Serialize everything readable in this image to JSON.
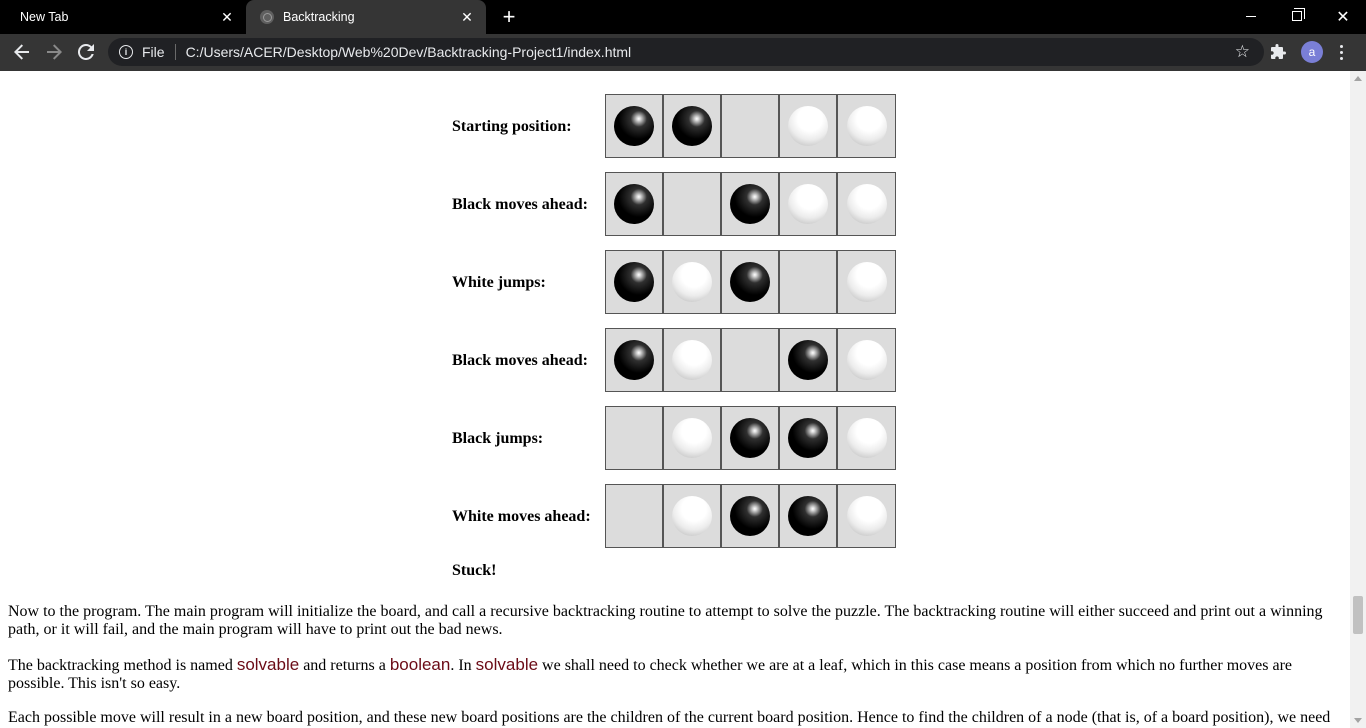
{
  "browser": {
    "tabs": [
      {
        "title": "New Tab",
        "active": false
      },
      {
        "title": "Backtracking",
        "active": true
      }
    ],
    "address": {
      "scheme_label": "File",
      "url": "C:/Users/ACER/Desktop/Web%20Dev/Backtracking-Project1/index.html"
    },
    "profile_initial": "a",
    "icons": [
      "back-icon",
      "forward-icon",
      "reload-icon",
      "info-icon",
      "star-icon",
      "extensions-icon",
      "menu-icon"
    ]
  },
  "moves": [
    {
      "label": "Starting position:",
      "board": [
        "black",
        "black",
        "empty",
        "white",
        "white"
      ]
    },
    {
      "label": "Black moves ahead:",
      "board": [
        "black",
        "empty",
        "black",
        "white",
        "white"
      ]
    },
    {
      "label": "White jumps:",
      "board": [
        "black",
        "white",
        "black",
        "empty",
        "white"
      ]
    },
    {
      "label": "Black moves ahead:",
      "board": [
        "black",
        "white",
        "empty",
        "black",
        "white"
      ]
    },
    {
      "label": "Black jumps:",
      "board": [
        "empty",
        "white",
        "black",
        "black",
        "white"
      ]
    },
    {
      "label": "White moves ahead:",
      "board": [
        "empty",
        "white",
        "black",
        "black",
        "white"
      ]
    }
  ],
  "stuck_text": "Stuck!",
  "paragraphs": {
    "p1": "Now to the program. The main program will initialize the board, and call a recursive backtracking routine to attempt to solve the puzzle. The backtracking routine will either succeed and print out a winning path, or it will fail, and the main program will have to print out the bad news.",
    "p2_a": "The backtracking method is named ",
    "p2_code1": "solvable",
    "p2_b": " and returns a ",
    "p2_code2": "boolean",
    "p2_c": ". In ",
    "p2_code3": "solvable",
    "p2_d": " we shall need to check whether we are at a leaf, which in this case means a position from which no further moves are possible. This isn't so easy.",
    "p3": "Each possible move will result in a new board position, and these new board positions are the children of the current board position. Hence to find the children of a node (that is, of a board position), we need"
  },
  "colors": {
    "code_text": "#6b0b16",
    "cell_bg": "#dcdcdc",
    "cell_border": "#555555",
    "chrome_dark": "#353535"
  }
}
